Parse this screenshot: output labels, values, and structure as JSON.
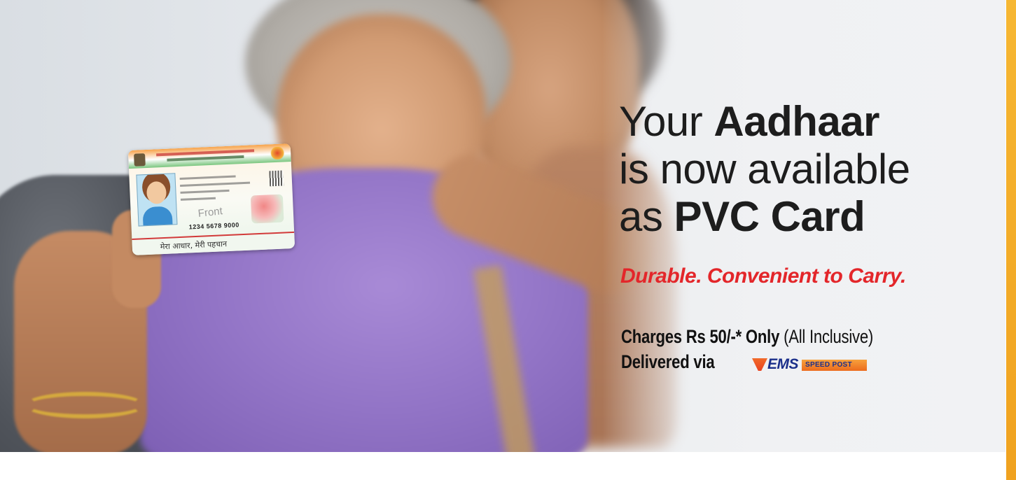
{
  "banner": {
    "headline": {
      "line1_prefix": "Your ",
      "line1_strong": "Aadhaar",
      "line2": "is now available",
      "line3_prefix": "as ",
      "line3_strong": "PVC Card"
    },
    "tagline": "Durable. Convenient to Carry.",
    "charges": {
      "strong": "Charges Rs 50/-* Only",
      "rest": " (All Inclusive)"
    },
    "delivered": "Delivered via",
    "ems_logo": {
      "word": "EMS",
      "sub": "SPEED POST"
    },
    "card": {
      "front_label": "Front",
      "number": "1234 5678 9000",
      "tagline": "मेरा आधार, मेरी पहचान"
    }
  },
  "colors": {
    "tagline": "#e3262a",
    "accent_stripe": "#f6b733",
    "ems_blue": "#1b2f8a",
    "ems_orange": "#f16a2a"
  }
}
